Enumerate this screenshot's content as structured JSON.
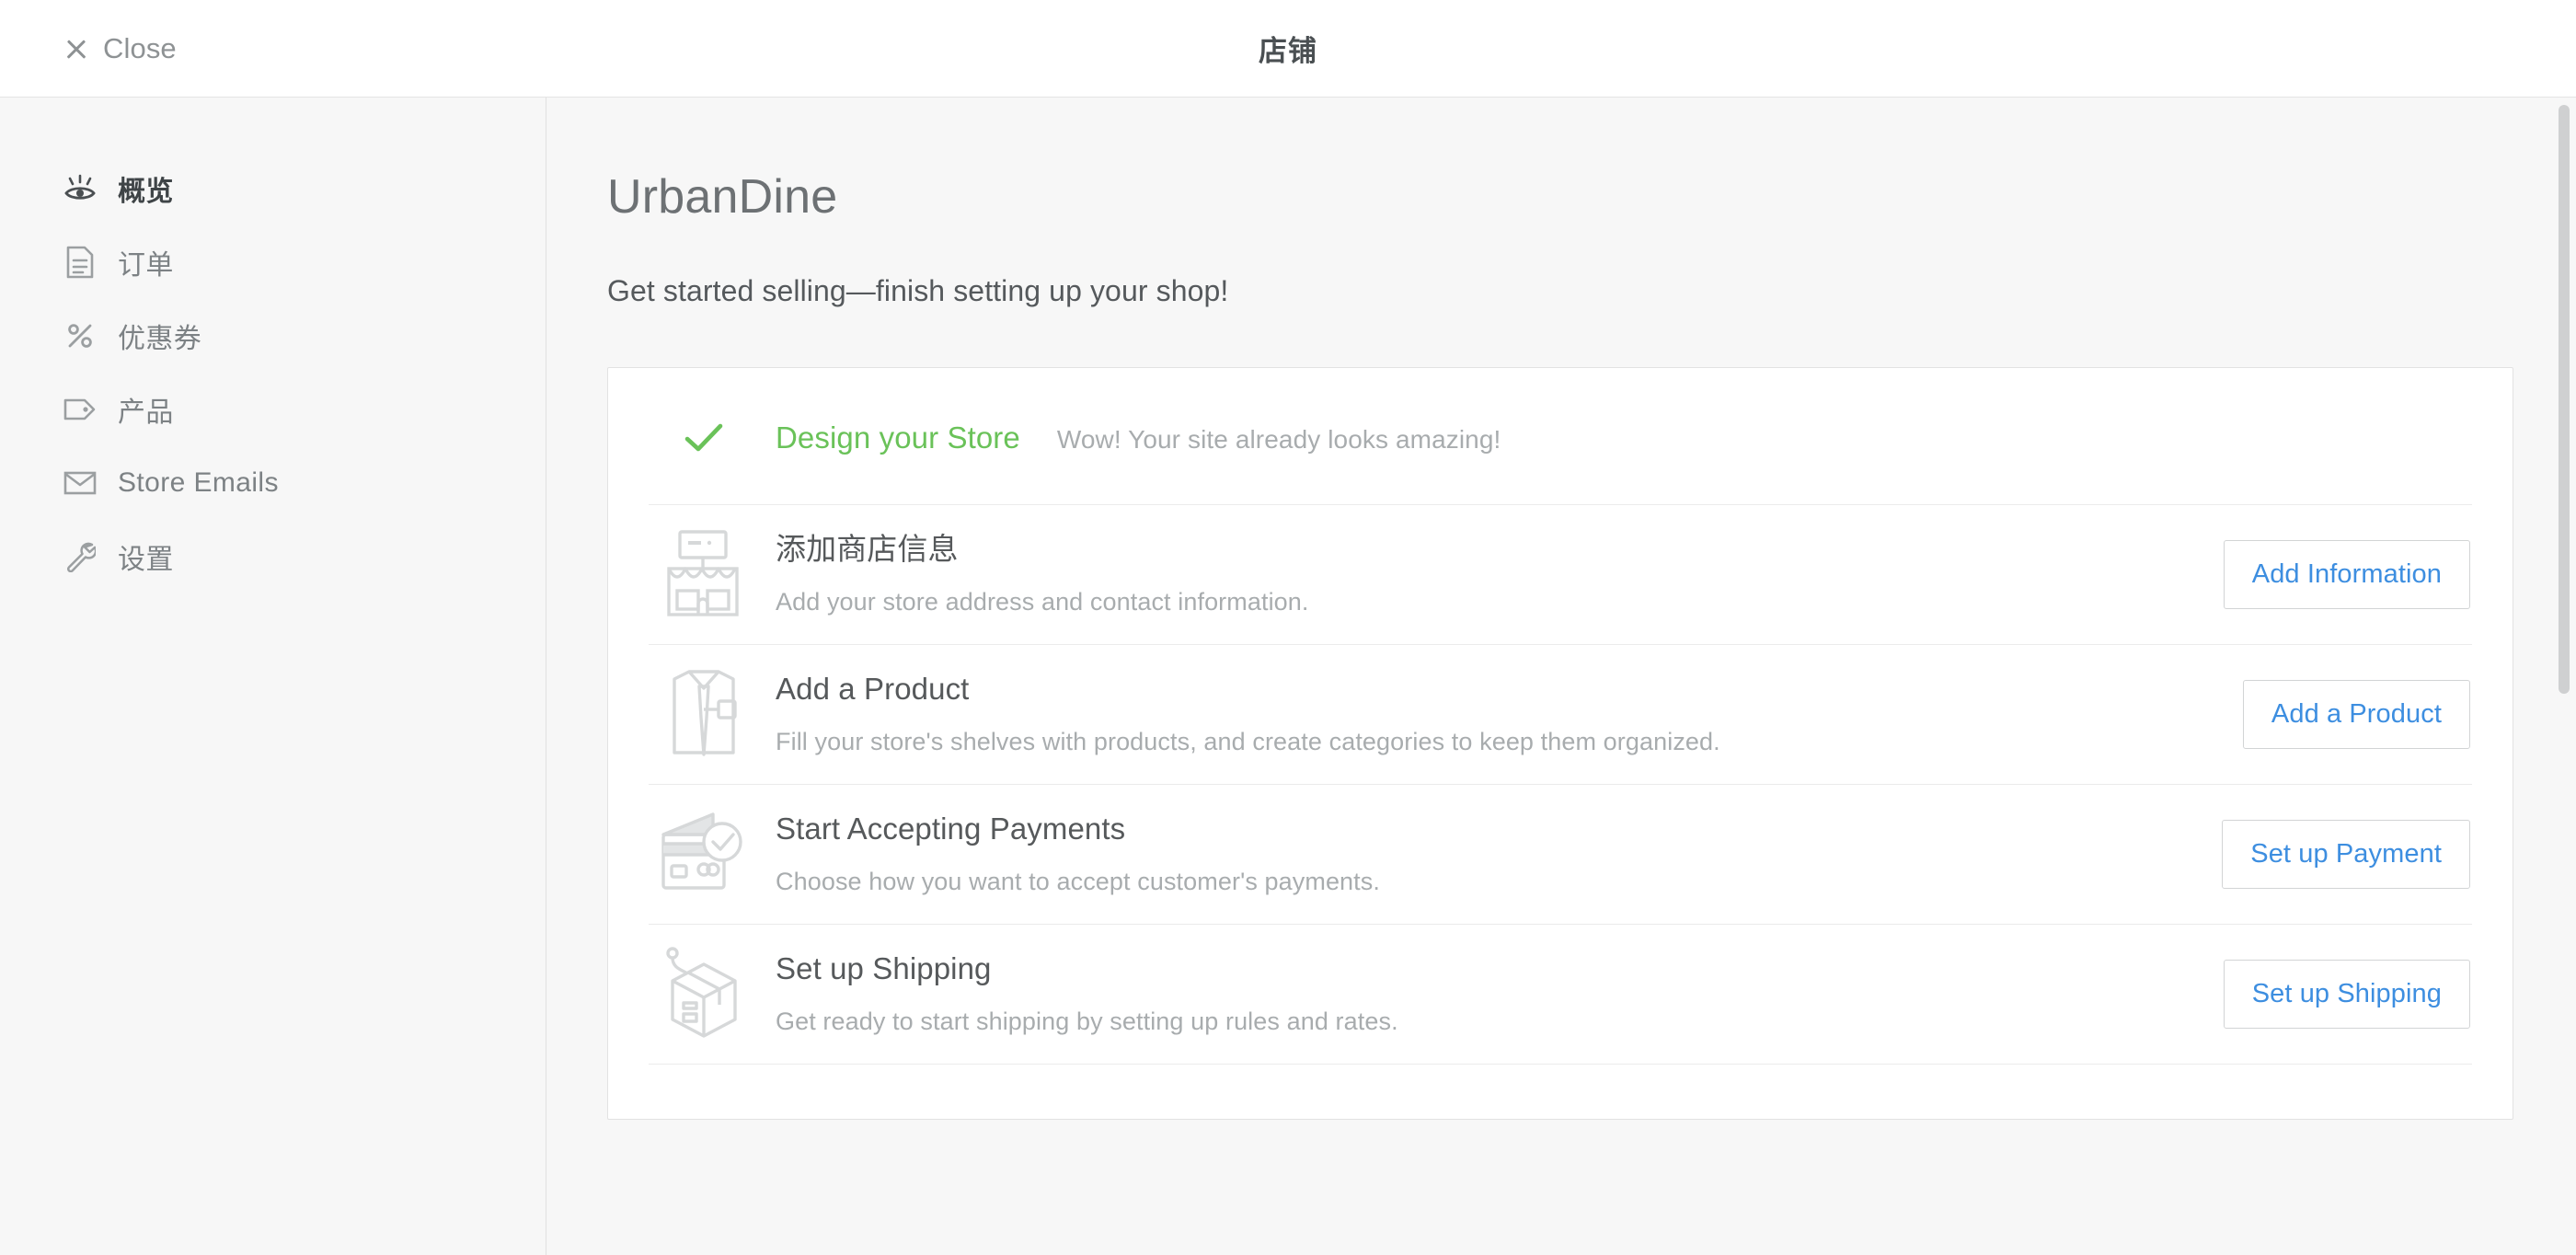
{
  "topbar": {
    "close_label": "Close",
    "title": "店铺",
    "close_icon": "close-icon"
  },
  "sidebar": {
    "items": [
      {
        "label": "概览",
        "icon": "eye-icon",
        "active": true
      },
      {
        "label": "订单",
        "icon": "document-icon",
        "active": false
      },
      {
        "label": "优惠券",
        "icon": "percent-icon",
        "active": false
      },
      {
        "label": "产品",
        "icon": "tag-icon",
        "active": false
      },
      {
        "label": "Store Emails",
        "icon": "envelope-icon",
        "active": false
      },
      {
        "label": "设置",
        "icon": "wrench-icon",
        "active": false
      }
    ]
  },
  "main": {
    "store_name": "UrbanDine",
    "subtitle": "Get started selling—finish setting up your shop!",
    "checklist": {
      "completed": {
        "icon": "check-icon",
        "title": "Design your Store",
        "note": "Wow! Your site already looks amazing!",
        "color": "#6ac259"
      },
      "items": [
        {
          "icon": "storefront-icon",
          "title": "添加商店信息",
          "desc": "Add your store address and contact information.",
          "button": "Add Information"
        },
        {
          "icon": "shirt-icon",
          "title": "Add a Product",
          "desc": "Fill your store's shelves with products, and create categories to keep them organized.",
          "button": "Add a Product"
        },
        {
          "icon": "credit-card-icon",
          "title": "Start Accepting Payments",
          "desc": "Choose how you want to accept customer's payments.",
          "button": "Set up Payment"
        },
        {
          "icon": "package-icon",
          "title": "Set up Shipping",
          "desc": "Get ready to start shipping by setting up rules and rates.",
          "button": "Set up Shipping"
        }
      ]
    }
  },
  "colors": {
    "accent_link": "#3d8ee0",
    "success": "#6ac259",
    "text_primary": "#56595b",
    "text_muted": "#a8acae",
    "page_bg": "#f7f7f7",
    "card_bg": "#ffffff",
    "border": "#e2e2e2"
  }
}
